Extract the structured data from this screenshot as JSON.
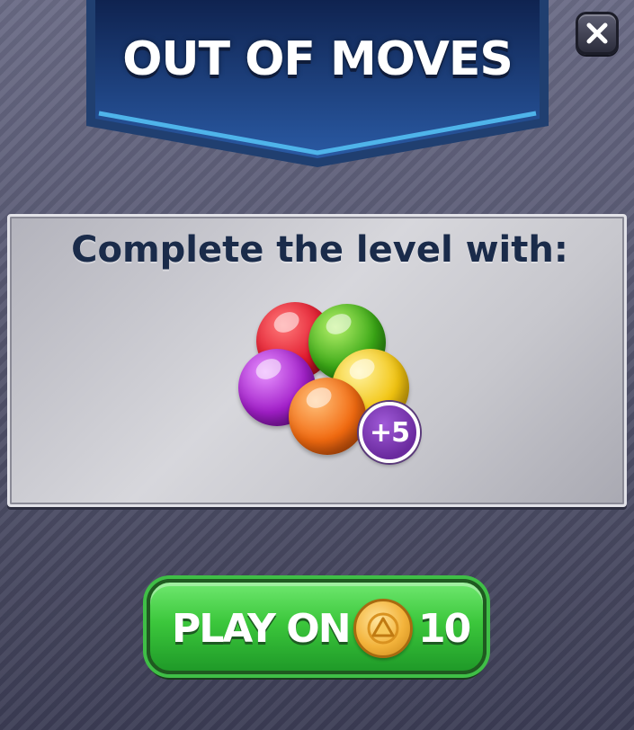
{
  "dialog": {
    "title": "OUT OF MOVES",
    "close_icon": "close-x-icon"
  },
  "offer": {
    "heading": "Complete the level with:",
    "bonus_badge": "+5",
    "ball_colors": [
      "#e0182c",
      "#3aa816",
      "#a21fc9",
      "#f2c410",
      "#f26a10"
    ]
  },
  "play_button": {
    "label": "PLAY ON",
    "price": "10",
    "coin_icon": "gold-coin-icon"
  },
  "colors": {
    "banner": "#1b3c78",
    "button_green": "#3cc73c",
    "heading": "#1a2b4a"
  }
}
